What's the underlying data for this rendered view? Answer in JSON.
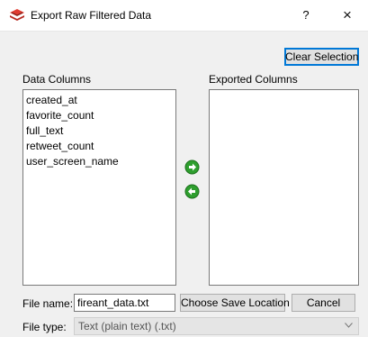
{
  "window": {
    "title": "Export Raw Filtered Data",
    "help_label": "?",
    "close_label": "×",
    "icon": "red-layers-app-icon"
  },
  "toolbar": {
    "clear_selection_label": "Clear Selection"
  },
  "data_columns": {
    "label": "Data Columns",
    "items": [
      "created_at",
      "favorite_count",
      "full_text",
      "retweet_count",
      "user_screen_name"
    ]
  },
  "exported_columns": {
    "label": "Exported Columns",
    "items": []
  },
  "transfer": {
    "add_icon": "green-arrow-right-icon",
    "remove_icon": "green-arrow-left-icon"
  },
  "file_name": {
    "label": "File name:",
    "value": "fireant_data.txt"
  },
  "buttons": {
    "choose_save_location": "Choose Save Location",
    "cancel": "Cancel"
  },
  "file_type": {
    "label": "File type:",
    "selected": "Text (plain text) (.txt)",
    "arrow_icon": "chevron-down-icon"
  },
  "colors": {
    "accent": "#0078d7",
    "arrow_green": "#2e9e2e"
  }
}
